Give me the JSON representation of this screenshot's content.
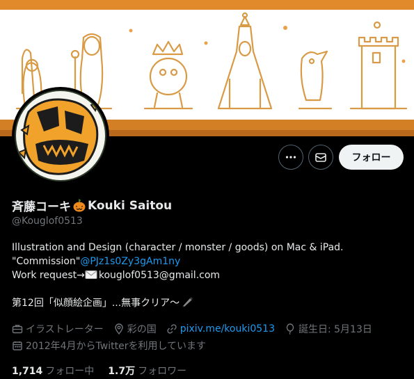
{
  "profile": {
    "name_part1": "斉藤コーキ",
    "name_part2": "Kouki Saitou",
    "handle": "@Kouglof0513"
  },
  "actions": {
    "more_label": "···",
    "follow_label": "フォロー"
  },
  "bio": {
    "line1": "Illustration and Design (character / monster / goods) on Mac & iPad.",
    "line2_prefix": "\"Commission\"",
    "line2_link": "@PJz1s0Zy3gAm1ny",
    "line3_prefix": "Work request→",
    "line3_email": "kouglof0513@gmail.com",
    "line4": "第12回「似顔絵企画」...無事クリア〜"
  },
  "meta": {
    "profession": "イラストレーター",
    "location": "彩の国",
    "website": "pixiv.me/kouki0513",
    "birthday": "誕生日: 5月13日",
    "joined": "2012年4月からTwitterを利用しています"
  },
  "stats": {
    "following_count": "1,714",
    "following_label": "フォロー中",
    "followers_count": "1.7万",
    "followers_label": "フォロワー"
  },
  "colors": {
    "banner_orange": "#e08a2c",
    "link_blue": "#1d9bf0",
    "muted_gray": "#71767b"
  }
}
